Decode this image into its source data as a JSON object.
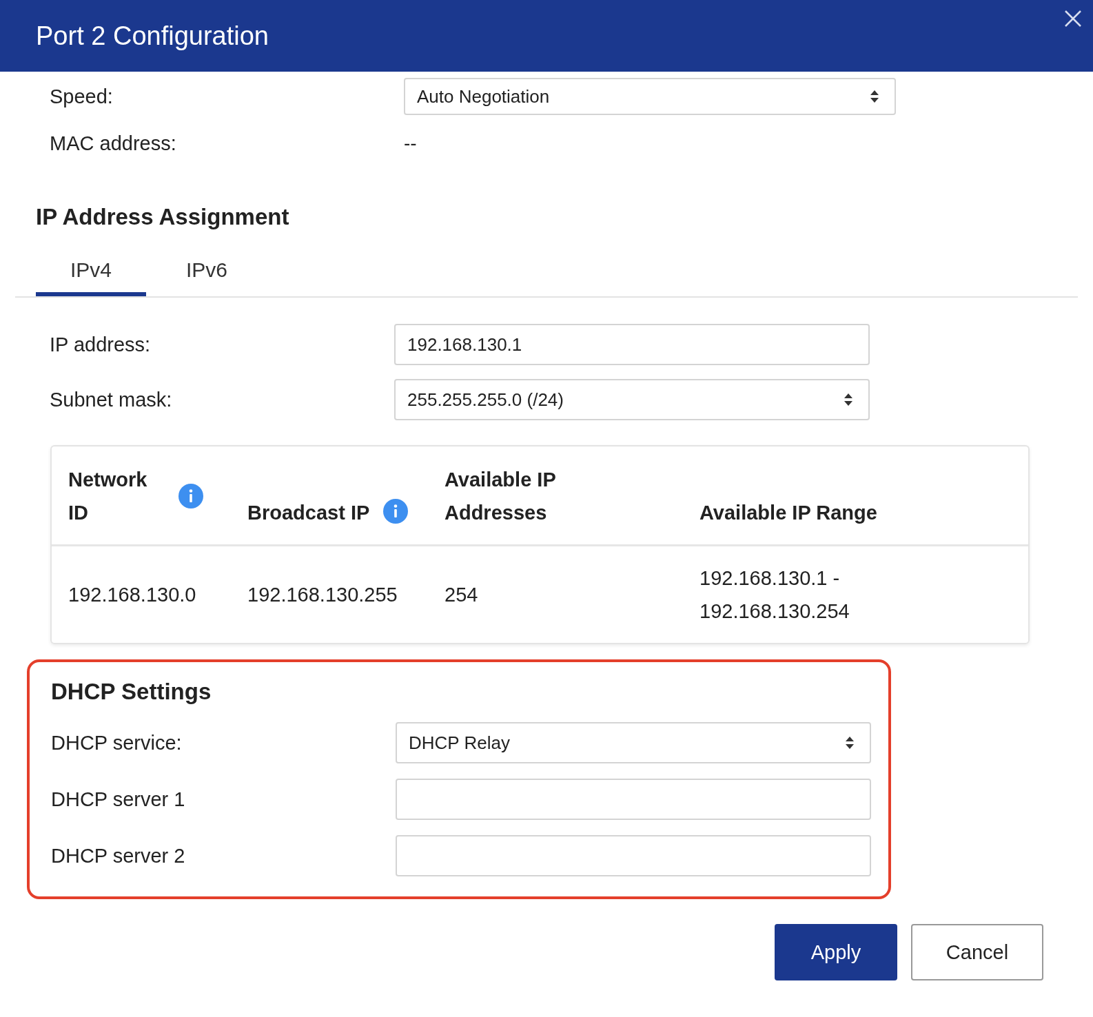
{
  "dialog": {
    "title": "Port 2 Configuration"
  },
  "port_fields": [
    {
      "label": "Speed:",
      "kind": "select",
      "value": "Auto Negotiation"
    },
    {
      "label": "MAC address:",
      "kind": "text",
      "value": "--"
    }
  ],
  "ip_section": {
    "title": "IP Address Assignment",
    "tabs": [
      {
        "label": "IPv4",
        "selected": true
      },
      {
        "label": "IPv6",
        "selected": false
      }
    ],
    "fields": [
      {
        "label": "IP address:",
        "kind": "input",
        "value": "192.168.130.1"
      },
      {
        "label": "Subnet mask:",
        "kind": "select",
        "value": "255.255.255.0 (/24)"
      }
    ],
    "table": {
      "columns": [
        {
          "label": "Network ID",
          "info": true
        },
        {
          "label": "Broadcast IP",
          "info": true
        },
        {
          "label": "Available IP Addresses",
          "info": false
        },
        {
          "label": "Available IP Range",
          "info": false
        }
      ],
      "rows": [
        [
          "192.168.130.0",
          "192.168.130.255",
          "254",
          "192.168.130.1 - 192.168.130.254"
        ]
      ]
    }
  },
  "dhcp": {
    "title": "DHCP Settings",
    "highlighted": true,
    "fields": [
      {
        "label": "DHCP service:",
        "kind": "select",
        "value": "DHCP Relay"
      },
      {
        "label": "DHCP server 1",
        "kind": "input"
      },
      {
        "label": "DHCP server 2",
        "kind": "input"
      }
    ]
  },
  "buttons": [
    {
      "label": "Apply",
      "kind": "primary"
    },
    {
      "label": "Cancel",
      "kind": "secondary"
    }
  ]
}
